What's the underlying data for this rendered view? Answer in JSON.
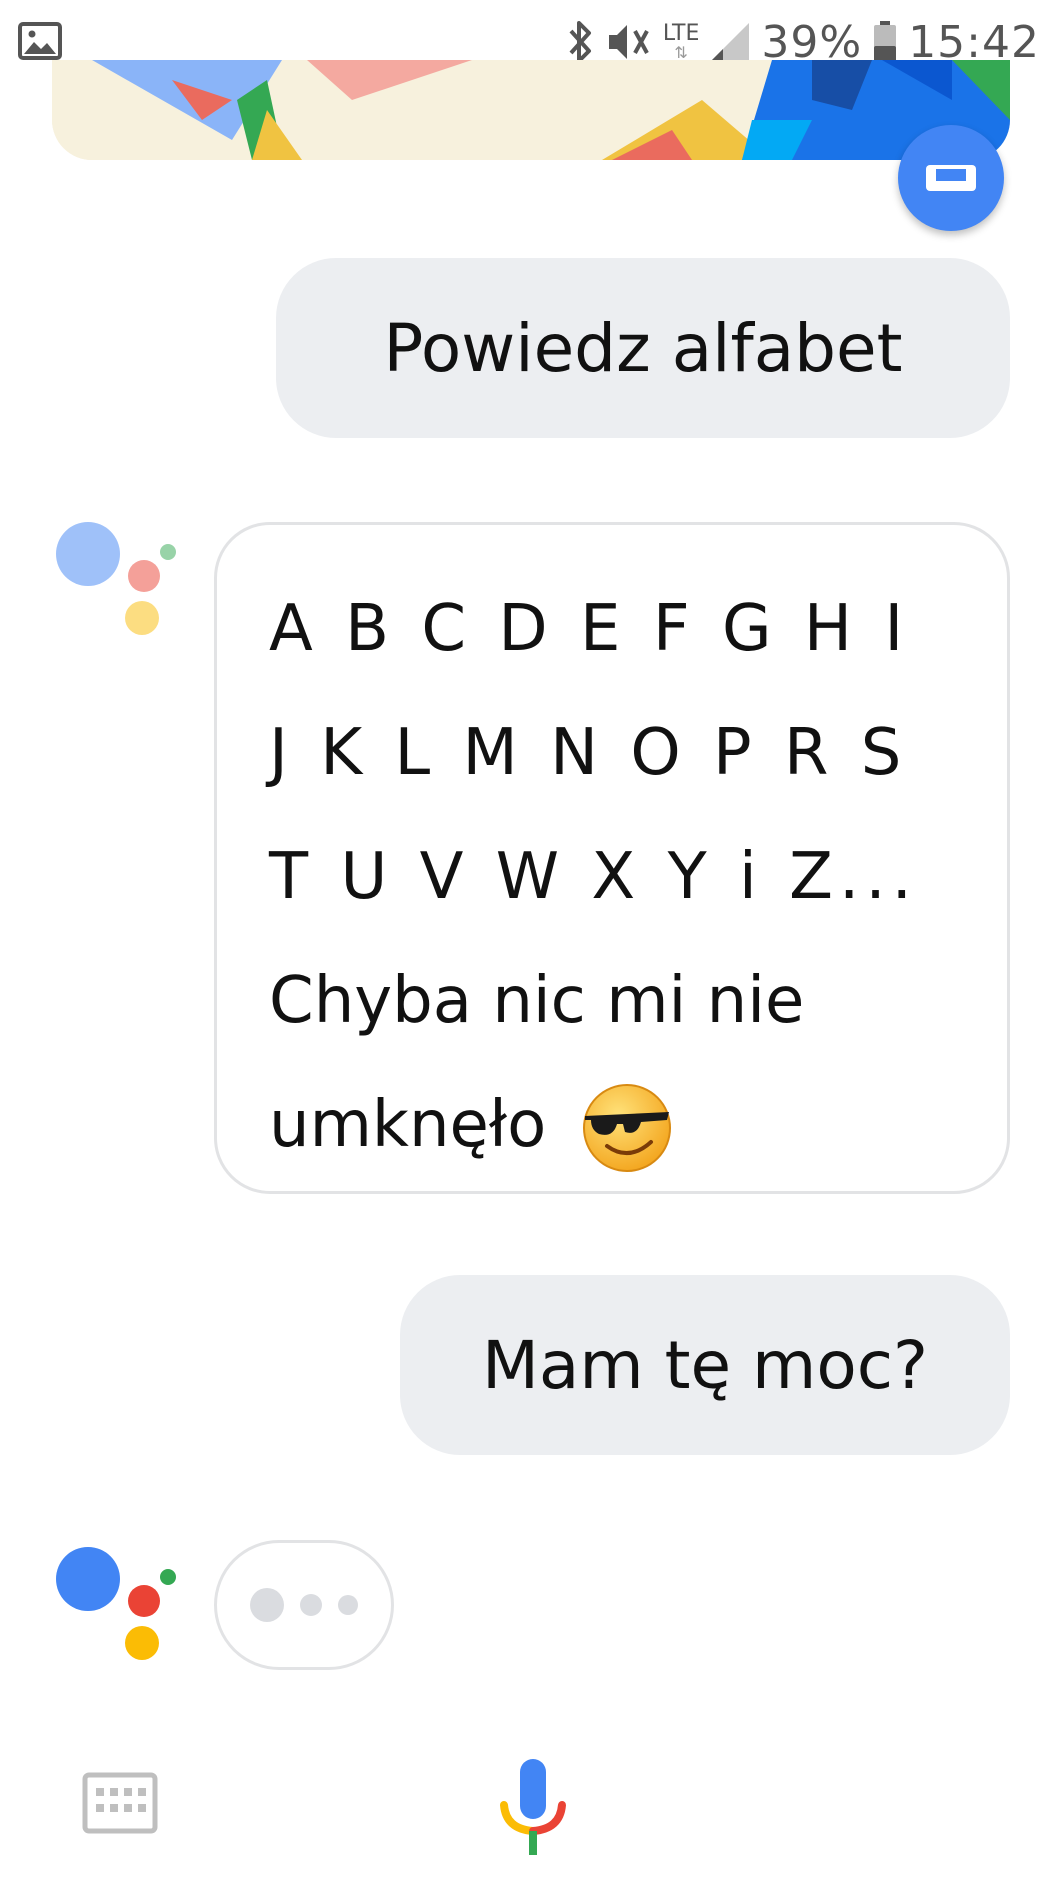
{
  "status_bar": {
    "left_icon": "image-icon",
    "icons": [
      "bluetooth-icon",
      "vibrate-icon",
      "lte-icon",
      "signal-icon",
      "battery-icon"
    ],
    "network": "LTE",
    "battery_percent": "39%",
    "time": "15:42"
  },
  "banner": {
    "button_icon": "screen-icon",
    "accent": "#4285f4"
  },
  "conversation": {
    "user_message_1": "Powiedz alfabet",
    "assistant_reply_lines": [
      "A B C D E F G H I",
      "J K L M N O P R S",
      "T U V W X Y i Z...",
      "Chyba nic mi nie",
      "umknęło"
    ],
    "assistant_reply_emoji": "smiling-face-with-sunglasses-icon",
    "user_message_2": "Mam tę moc?",
    "typing_indicator": "typing-dots-icon"
  },
  "bottom_bar": {
    "keyboard_icon": "keyboard-icon",
    "mic_icon": "mic-icon"
  },
  "colors": {
    "assistant_blue": "#4285f4",
    "assistant_red": "#ea4335",
    "assistant_yellow": "#fbbc05",
    "assistant_green": "#34a853",
    "user_bubble": "#eceef1"
  }
}
